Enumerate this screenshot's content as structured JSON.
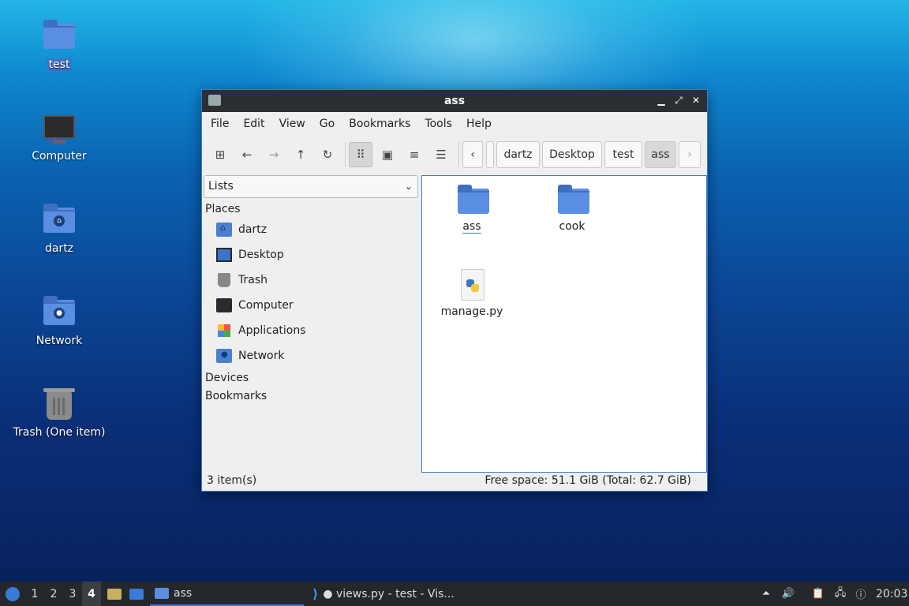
{
  "desktop": {
    "icons": [
      {
        "label": "test",
        "selected": true,
        "icon": "folder-icon"
      },
      {
        "label": "Computer",
        "icon": "computer-icon"
      },
      {
        "label": "dartz",
        "icon": "home-folder-icon"
      },
      {
        "label": "Network",
        "icon": "network-folder-icon"
      },
      {
        "label": "Trash (One item)",
        "icon": "trash-icon"
      }
    ]
  },
  "window": {
    "title": "ass",
    "controls": {
      "minimize": "▁",
      "maximize": "⤢",
      "close": "✕"
    },
    "menu": [
      "File",
      "Edit",
      "View",
      "Go",
      "Bookmarks",
      "Tools",
      "Help"
    ],
    "toolbar": {
      "icons": [
        "new-tab-icon",
        "back-arrow-icon",
        "forward-arrow-icon",
        "up-arrow-icon",
        "reload-icon",
        "icon-view-icon",
        "thumbnail-view-icon",
        "compact-view-icon",
        "detailed-list-view-icon"
      ],
      "glyphs": {
        "new_tab": "⊞",
        "back": "←",
        "forward": "→",
        "up": "↑",
        "reload": "↻",
        "icon_view": "⠿",
        "thumb_view": "▣",
        "compact_view": "≡",
        "list_view": "☰",
        "prev": "‹",
        "next": "›"
      }
    },
    "breadcrumb": [
      "dartz",
      "Desktop",
      "test",
      "ass"
    ],
    "sidebar": {
      "mode": "Lists",
      "chevron": "⌄",
      "sections": {
        "places": "Places",
        "devices": "Devices",
        "bookmarks": "Bookmarks"
      },
      "places": [
        {
          "label": "dartz",
          "icon": "home-folder-icon"
        },
        {
          "label": "Desktop",
          "icon": "desktop-icon"
        },
        {
          "label": "Trash",
          "icon": "trash-icon"
        },
        {
          "label": "Computer",
          "icon": "computer-icon"
        },
        {
          "label": "Applications",
          "icon": "applications-icon"
        },
        {
          "label": "Network",
          "icon": "network-folder-icon"
        }
      ]
    },
    "files": [
      {
        "name": "ass",
        "type": "folder"
      },
      {
        "name": "cook",
        "type": "folder"
      },
      {
        "name": "manage.py",
        "type": "python"
      }
    ],
    "status": {
      "count": "3 item(s)",
      "space": "Free space: 51.1 GiB (Total: 62.7 GiB)"
    }
  },
  "taskbar": {
    "workspaces": [
      "1",
      "2",
      "3",
      "4"
    ],
    "current_workspace": "4",
    "tasks": [
      {
        "label": "ass",
        "icon": "folder-icon",
        "active": true
      },
      {
        "label": "● views.py - test - Vis...",
        "icon": "vscode-icon",
        "active": false
      }
    ],
    "clock": "20:03"
  }
}
